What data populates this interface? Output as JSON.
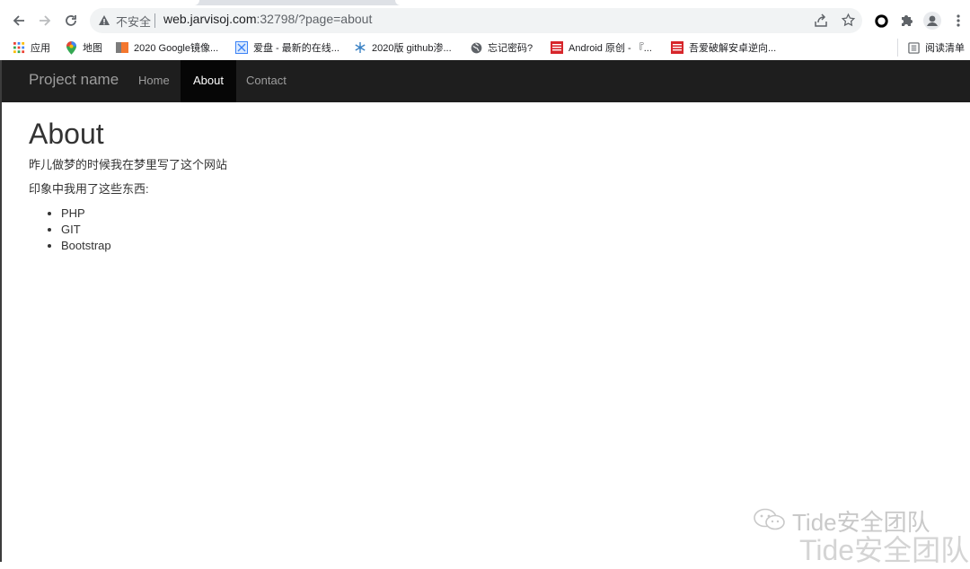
{
  "browser": {
    "omnibox": {
      "security_label": "不安全",
      "url_host": "web.jarvisoj.com",
      "url_rest": ":32798/?page=about"
    },
    "bookmarks": [
      {
        "label": "应用",
        "icon": "apps-grid-icon"
      },
      {
        "label": "地图",
        "icon": "maps-pin-icon"
      },
      {
        "label": "2020 Google镜像...",
        "icon": "bookmark-favicon-icon"
      },
      {
        "label": "爱盘 - 最新的在线...",
        "icon": "bookmark-favicon-icon"
      },
      {
        "label": "2020版 github渗...",
        "icon": "bookmark-favicon-icon"
      },
      {
        "label": "忘记密码?",
        "icon": "globe-icon"
      },
      {
        "label": "Android 原创 - 『...",
        "icon": "bookmark-favicon-icon"
      },
      {
        "label": "吾爱破解安卓逆向...",
        "icon": "bookmark-favicon-icon"
      }
    ],
    "reading_list": "阅读清单"
  },
  "navbar": {
    "brand": "Project name",
    "links": [
      {
        "label": "Home",
        "active": false
      },
      {
        "label": "About",
        "active": true
      },
      {
        "label": "Contact",
        "active": false
      }
    ]
  },
  "main": {
    "heading": "About",
    "paragraph1": "昨儿做梦的时候我在梦里写了这个网站",
    "paragraph2": "印象中我用了这些东西:",
    "list": [
      "PHP",
      "GIT",
      "Bootstrap"
    ]
  },
  "watermark": {
    "line1": "Tide安全团队",
    "line2": "Tide安全团队"
  },
  "colors": {
    "navbar_bg": "#1e1e1e",
    "navbar_active": "#060606",
    "nav_text": "#9d9d9d",
    "text": "#333333"
  }
}
